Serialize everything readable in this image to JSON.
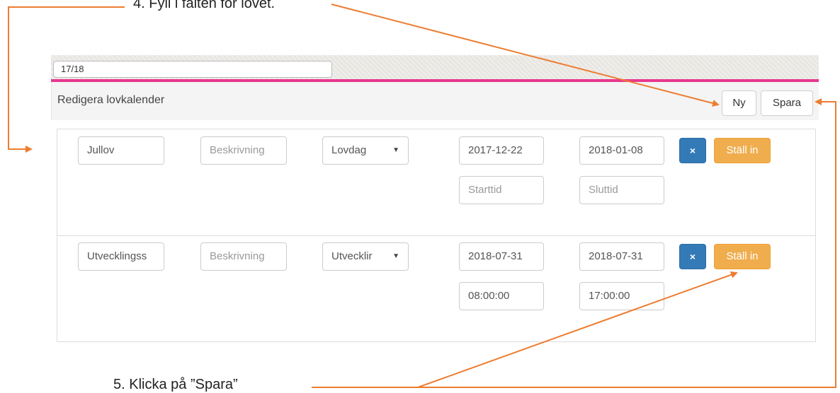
{
  "captions": {
    "top": "4.   Fyll i fälten för lovet.",
    "bottom": "5.   Klicka på ”Spara”"
  },
  "term": {
    "value": "17/18"
  },
  "panel": {
    "title": "Redigera lovkalender",
    "new_label": "Ny",
    "save_label": "Spara"
  },
  "rows": [
    {
      "name": "Jullov",
      "description_placeholder": "Beskrivning",
      "type": "Lovdag",
      "start_date": "2017-12-22",
      "end_date": "2018-01-08",
      "start_time_placeholder": "Starttid",
      "end_time_placeholder": "Sluttid",
      "delete_icon": "×",
      "cancel_label": "Ställ in"
    },
    {
      "name": "Utvecklingss",
      "description_placeholder": "Beskrivning",
      "type": "Utvecklir",
      "start_date": "2018-07-31",
      "end_date": "2018-07-31",
      "start_time": "08:00:00",
      "end_time": "17:00:00",
      "delete_icon": "×",
      "cancel_label": "Ställ in"
    }
  ],
  "icons": {
    "select_arrow": "▼"
  },
  "colors": {
    "accent_bar": "#e8388f",
    "primary": "#337ab7",
    "warning": "#f0ad4e",
    "annotation": "#ed7d31"
  }
}
